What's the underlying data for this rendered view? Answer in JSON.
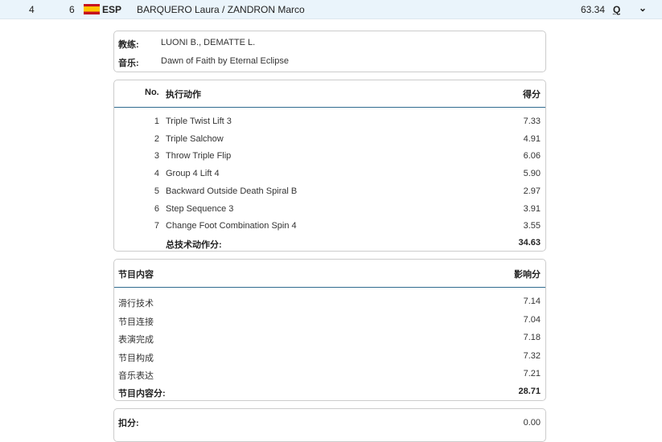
{
  "header": {
    "rank": "4",
    "start_no": "6",
    "nation": "ESP",
    "name": "BARQUERO Laura / ZANDRON Marco",
    "score": "63.34",
    "qualified": "Q"
  },
  "info": {
    "coach_label": "教练:",
    "coach": "LUONI B., DEMATTE L.",
    "music_label": "音乐:",
    "music": "Dawn of Faith by Eternal Eclipse"
  },
  "elements": {
    "col_no": "No.",
    "col_name": "执行动作",
    "col_score": "得分",
    "rows": [
      {
        "no": "1",
        "name": "Triple Twist Lift 3",
        "score": "7.33"
      },
      {
        "no": "2",
        "name": "Triple Salchow",
        "score": "4.91"
      },
      {
        "no": "3",
        "name": "Throw Triple Flip",
        "score": "6.06"
      },
      {
        "no": "4",
        "name": "Group 4 Lift 4",
        "score": "5.90"
      },
      {
        "no": "5",
        "name": "Backward Outside Death Spiral B",
        "score": "2.97"
      },
      {
        "no": "6",
        "name": "Step Sequence 3",
        "score": "3.91"
      },
      {
        "no": "7",
        "name": "Change Foot Combination Spin 4",
        "score": "3.55"
      }
    ],
    "total_label": "总技术动作分:",
    "total": "34.63"
  },
  "components": {
    "col_name": "节目内容",
    "col_score": "影响分",
    "rows": [
      {
        "name": "滑行技术",
        "score": "7.14"
      },
      {
        "name": "节目连接",
        "score": "7.04"
      },
      {
        "name": "表演完成",
        "score": "7.18"
      },
      {
        "name": "节目构成",
        "score": "7.32"
      },
      {
        "name": "音乐表达",
        "score": "7.21"
      }
    ],
    "total_label": "节目内容分:",
    "total": "28.71"
  },
  "deductions": {
    "label": "扣分:",
    "value": "0.00"
  }
}
